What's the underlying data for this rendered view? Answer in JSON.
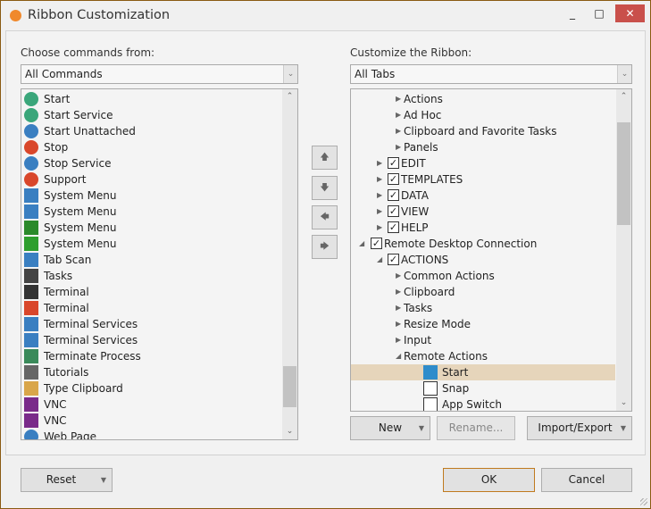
{
  "window": {
    "title": "Ribbon Customization",
    "minimize": "_",
    "maximize": "□",
    "close": "✕",
    "accent": "#c9504b",
    "border": "#8a5a12"
  },
  "left": {
    "label": "Choose commands from:",
    "combo": "All Commands",
    "items": [
      {
        "label": "Start",
        "icon": "power-green-icon",
        "color": "#3aa67a"
      },
      {
        "label": "Start Service",
        "icon": "play-green-icon",
        "color": "#3aa67a"
      },
      {
        "label": "Start Unattached",
        "icon": "window-play-icon",
        "color": "#3a7fc1"
      },
      {
        "label": "Stop",
        "icon": "power-red-icon",
        "color": "#d9472b"
      },
      {
        "label": "Stop Service",
        "icon": "stop-blue-icon",
        "color": "#3a7fc1"
      },
      {
        "label": "Support",
        "icon": "lifebuoy-icon",
        "color": "#d9472b"
      },
      {
        "label": "System Menu",
        "icon": "window-gear-icon",
        "color": "#3a7fc1"
      },
      {
        "label": "System Menu",
        "icon": "window-gear-icon",
        "color": "#3a7fc1"
      },
      {
        "label": "System Menu",
        "icon": "vim-icon",
        "color": "#2b8a2b"
      },
      {
        "label": "System Menu",
        "icon": "eye-green-icon",
        "color": "#2e9e2e"
      },
      {
        "label": "Tab Scan",
        "icon": "binoculars-icon",
        "color": "#3a7fc1"
      },
      {
        "label": "Tasks",
        "icon": "console-icon",
        "color": "#444444"
      },
      {
        "label": "Terminal",
        "icon": "terminal-icon",
        "color": "#333333"
      },
      {
        "label": "Terminal",
        "icon": "terminal-window-icon",
        "color": "#d9472b"
      },
      {
        "label": "Terminal Services",
        "icon": "network-icon",
        "color": "#3a7fc1"
      },
      {
        "label": "Terminal Services",
        "icon": "network-window-icon",
        "color": "#3a7fc1"
      },
      {
        "label": "Terminate Process",
        "icon": "gear-x-icon",
        "color": "#3a8a5a"
      },
      {
        "label": "Tutorials",
        "icon": "graduation-cap-icon",
        "color": "#666666"
      },
      {
        "label": "Type  Clipboard",
        "icon": "clipboard-icon",
        "color": "#d9a64a"
      },
      {
        "label": "VNC",
        "icon": "vnc-icon",
        "color": "#7a2b8a"
      },
      {
        "label": "VNC",
        "icon": "vnc-monitor-icon",
        "color": "#7a2b8a"
      },
      {
        "label": "Web Page",
        "icon": "globe-icon",
        "color": "#3a7fc1"
      }
    ]
  },
  "move": {
    "up": "🡅",
    "down": "🡇",
    "left": "🡄",
    "right": "🡆"
  },
  "right": {
    "label": "Customize the Ribbon:",
    "combo": "All Tabs",
    "items": [
      {
        "label": "Actions",
        "level": 2,
        "expander": "collapsed"
      },
      {
        "label": "Ad Hoc",
        "level": 2,
        "expander": "collapsed"
      },
      {
        "label": "Clipboard and Favorite Tasks",
        "level": 2,
        "expander": "collapsed"
      },
      {
        "label": "Panels",
        "level": 2,
        "expander": "collapsed"
      },
      {
        "label": "EDIT",
        "level": 1,
        "expander": "collapsed",
        "checked": true
      },
      {
        "label": "TEMPLATES",
        "level": 1,
        "expander": "collapsed",
        "checked": true
      },
      {
        "label": "DATA",
        "level": 1,
        "expander": "collapsed",
        "checked": true
      },
      {
        "label": "VIEW",
        "level": 1,
        "expander": "collapsed",
        "checked": true
      },
      {
        "label": "HELP",
        "level": 1,
        "expander": "collapsed",
        "checked": true
      },
      {
        "label": "Remote Desktop Connection",
        "level": 0,
        "expander": "expanded",
        "checked": true
      },
      {
        "label": "ACTIONS",
        "level": 1,
        "expander": "expanded",
        "checked": true
      },
      {
        "label": "Common Actions",
        "level": 2,
        "expander": "collapsed"
      },
      {
        "label": "Clipboard",
        "level": 2,
        "expander": "collapsed"
      },
      {
        "label": "Tasks",
        "level": 2,
        "expander": "collapsed"
      },
      {
        "label": "Resize Mode",
        "level": 2,
        "expander": "collapsed"
      },
      {
        "label": "Input",
        "level": 2,
        "expander": "collapsed"
      },
      {
        "label": "Remote Actions",
        "level": 2,
        "expander": "expanded"
      },
      {
        "label": "Start",
        "level": 3,
        "icon": "windows-logo-icon",
        "selected": true
      },
      {
        "label": "Snap",
        "level": 3,
        "icon": "snap-icon"
      },
      {
        "label": "App Switch",
        "level": 3,
        "icon": "app-switch-icon"
      }
    ],
    "selected_color": "#e6d5bb"
  },
  "buttons": {
    "new": "New",
    "rename": "Rename...",
    "import_export": "Import/Export",
    "reset": "Reset",
    "ok": "OK",
    "cancel": "Cancel"
  }
}
